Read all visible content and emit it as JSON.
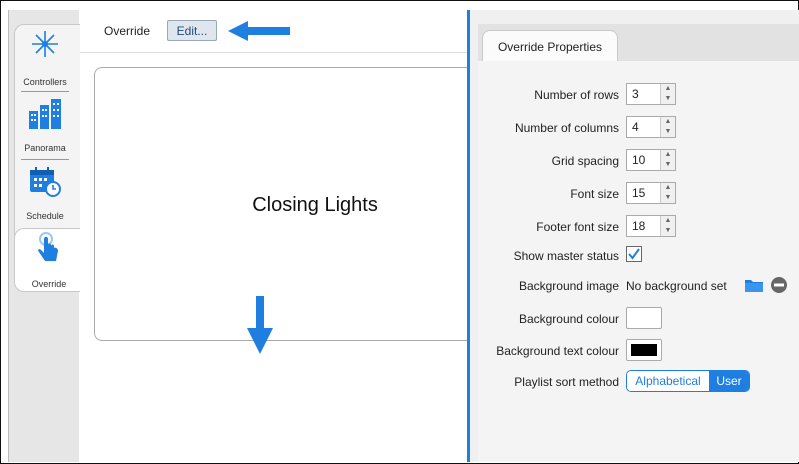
{
  "sidebar": {
    "items": [
      {
        "label": "Controllers",
        "icon": "sparkle-icon"
      },
      {
        "label": "Panorama",
        "icon": "building-icon"
      },
      {
        "label": "Schedule",
        "icon": "calendar-clock-icon"
      },
      {
        "label": "Override",
        "icon": "touch-hand-icon"
      }
    ],
    "active": "Override"
  },
  "toolbar": {
    "title": "Override",
    "edit_label": "Edit..."
  },
  "card": {
    "title": "Closing Lights"
  },
  "panel": {
    "tab": "Override Properties",
    "rows": {
      "rows": {
        "label": "Number of rows",
        "value": "3"
      },
      "cols": {
        "label": "Number of columns",
        "value": "4"
      },
      "grid": {
        "label": "Grid spacing",
        "value": "10"
      },
      "font": {
        "label": "Font size",
        "value": "15"
      },
      "footer": {
        "label": "Footer font size",
        "value": "18"
      },
      "master": {
        "label": "Show master status",
        "checked": true
      },
      "bgimage": {
        "label": "Background image",
        "value": "No background set"
      },
      "bgcol": {
        "label": "Background colour",
        "color": "#ffffff"
      },
      "bgtext": {
        "label": "Background text colour",
        "color": "#000000"
      },
      "sort": {
        "label": "Playlist sort method",
        "options": [
          "Alphabetical",
          "User"
        ],
        "selected": "User"
      }
    }
  },
  "colors": {
    "accent": "#1e7fe0"
  }
}
